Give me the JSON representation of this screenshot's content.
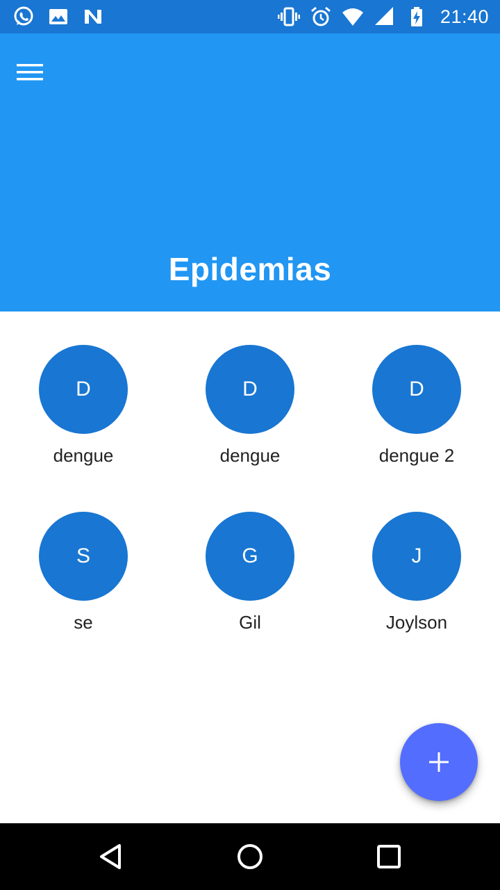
{
  "status_bar": {
    "time": "21:40",
    "left_icons": [
      "whatsapp-icon",
      "image-icon",
      "n-notification-icon"
    ],
    "right_icons": [
      "vibrate-icon",
      "alarm-icon",
      "wifi-icon",
      "signal-icon",
      "battery-charging-icon"
    ]
  },
  "app_bar": {
    "title": "Epidemias",
    "background": "#2196F3",
    "menu_icon": "menu-icon"
  },
  "items": [
    {
      "initial": "D",
      "label": "dengue"
    },
    {
      "initial": "D",
      "label": "dengue"
    },
    {
      "initial": "D",
      "label": "dengue 2"
    },
    {
      "initial": "S",
      "label": "se"
    },
    {
      "initial": "G",
      "label": "Gil"
    },
    {
      "initial": "J",
      "label": "Joylson"
    }
  ],
  "avatar_color": "#1976D2",
  "fab": {
    "icon": "plus-icon",
    "color": "#536DFE"
  },
  "nav_bar": {
    "buttons": [
      "back-icon",
      "home-icon",
      "recents-icon"
    ]
  }
}
